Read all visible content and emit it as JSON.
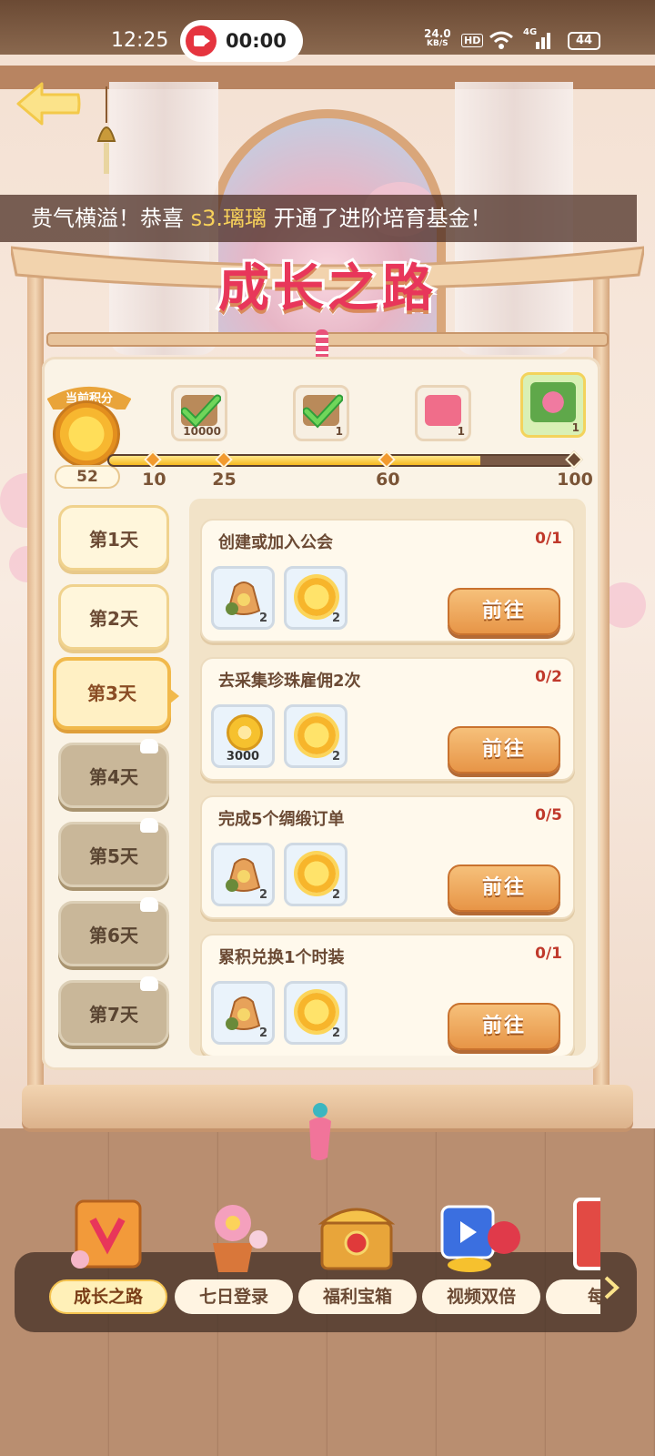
{
  "status_bar": {
    "time": "12:25",
    "recording_time": "00:00",
    "net_speed_value": "24.0",
    "net_speed_unit": "KB/S",
    "hd_badge": "HD",
    "network_type": "4G",
    "battery": "44"
  },
  "notice": {
    "prefix": "贵气横溢！恭喜",
    "player": "s3.璃璃",
    "suffix": "开通了进阶培育基金！"
  },
  "title": "成长之路",
  "score": {
    "label": "当前积分",
    "value": "52",
    "progress_fraction": 0.8,
    "milestones": [
      {
        "value": "10",
        "reward_qty": "10000",
        "claimed": true,
        "icon": "gift-box-icon"
      },
      {
        "value": "25",
        "reward_qty": "1",
        "claimed": true,
        "icon": "gift-box-icon"
      },
      {
        "value": "60",
        "reward_qty": "1",
        "claimed": false,
        "icon": "red-envelope-icon"
      },
      {
        "value": "100",
        "reward_qty": "1",
        "claimed": false,
        "icon": "flower-pot-icon"
      }
    ]
  },
  "days": [
    {
      "label": "第1天",
      "state": "open"
    },
    {
      "label": "第2天",
      "state": "open"
    },
    {
      "label": "第3天",
      "state": "active"
    },
    {
      "label": "第4天",
      "state": "locked"
    },
    {
      "label": "第5天",
      "state": "locked"
    },
    {
      "label": "第6天",
      "state": "locked"
    },
    {
      "label": "第7天",
      "state": "locked"
    }
  ],
  "tasks": [
    {
      "title": "创建或加入公会",
      "progress": "0/1",
      "rewards": [
        {
          "icon": "lucky-bag-icon",
          "qty": "2"
        },
        {
          "icon": "sun-icon",
          "qty": "2"
        }
      ],
      "button": "前往"
    },
    {
      "title": "去采集珍珠雇佣2次",
      "progress": "0/2",
      "rewards": [
        {
          "icon": "coin-icon",
          "qty": "3000"
        },
        {
          "icon": "sun-icon",
          "qty": "2"
        }
      ],
      "button": "前往"
    },
    {
      "title": "完成5个绸缎订单",
      "progress": "0/5",
      "rewards": [
        {
          "icon": "lucky-bag-icon",
          "qty": "2"
        },
        {
          "icon": "sun-icon",
          "qty": "2"
        }
      ],
      "button": "前往"
    },
    {
      "title": "累积兑换1个时装",
      "progress": "0/1",
      "rewards": [
        {
          "icon": "lucky-bag-icon",
          "qty": "2"
        },
        {
          "icon": "sun-icon",
          "qty": "2"
        }
      ],
      "button": "前往"
    }
  ],
  "bottom_nav": [
    {
      "label": "成长之路",
      "icon": "growth-banner-icon",
      "active": true
    },
    {
      "label": "七日登录",
      "icon": "flower-pot-icon",
      "active": false
    },
    {
      "label": "福利宝箱",
      "icon": "treasure-chest-icon",
      "active": false
    },
    {
      "label": "视频双倍",
      "icon": "video-coins-icon",
      "active": false
    },
    {
      "label": "每日",
      "icon": "sign-in-icon",
      "active": false
    }
  ],
  "colors": {
    "title": "#e8365a",
    "progress_fill": "#f6b91f",
    "button": "#e79547",
    "task_progress": "#c0392b"
  }
}
